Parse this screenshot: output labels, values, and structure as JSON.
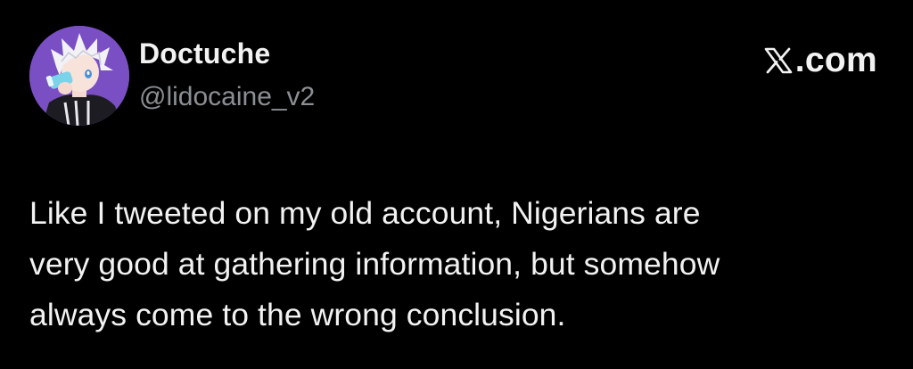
{
  "author": {
    "display_name": "Doctuche",
    "handle": "@lidocaine_v2",
    "avatar_icon": "anime-avatar-icon",
    "avatar_bg": "#7b4fc4"
  },
  "watermark": {
    "logo_icon": "x-logo-icon",
    "text": ".com"
  },
  "tweet": {
    "lines": [
      "Like I tweeted on my old account, Nigerians are",
      "very good at gathering information, but somehow",
      "always come to the wrong conclusion."
    ]
  },
  "colors": {
    "background": "#000000",
    "text_primary": "#f2f2f2",
    "text_secondary": "#8b8f94"
  }
}
